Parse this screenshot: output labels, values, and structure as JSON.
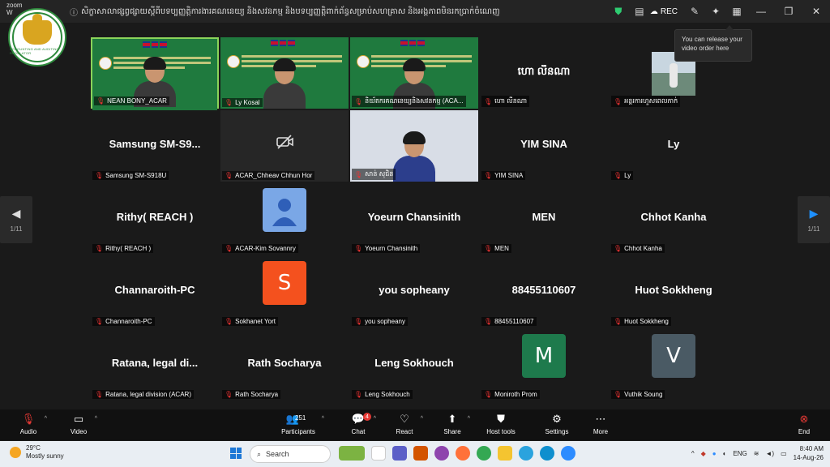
{
  "window": {
    "app_name_line1": "zoom",
    "app_name_line2": "W",
    "title": "សិក្ខាសាលាផ្សព្វផ្សាយស្ដីពីបទប្បញ្ញត្តិការងារគណនេយ្យ និងសវនកម្ម និងបទប្បញ្ញត្តិពាក់ព័ន្ធសម្រាប់សហគ្រាស និងអង្គភាពមិនរកប្រាក់ចំណេញ",
    "rec_label": "REC",
    "colors": {
      "titlebar": "#242424",
      "shield": "#2ecc71"
    }
  },
  "logo": {
    "caption": "ACCOUNTING AND AUDITING REGULATOR"
  },
  "tooltip": {
    "text": "You can release your video order here"
  },
  "tiles": [
    {
      "id": "nean",
      "name": "NEAN BONY_ACAR",
      "type": "video",
      "active": true
    },
    {
      "id": "lykosal",
      "name": "Ly Kosal",
      "type": "video"
    },
    {
      "id": "acar",
      "name": "និយ័តករគណនេយ្យនិងសវនកម្ម (ACA...",
      "type": "video"
    },
    {
      "id": "hem",
      "name": "ហោ លីនណា",
      "center": "ហោ លីនណា",
      "type": "name"
    },
    {
      "id": "anon",
      "name": "អន្តរការហួសពេលភាក់",
      "type": "photo"
    },
    {
      "id": "samsung",
      "name": "Samsung SM-S918U",
      "center": "Samsung  SM-S9...",
      "type": "name"
    },
    {
      "id": "chheav",
      "name": "ACAR_Chheav Chhun Hor",
      "type": "camoff"
    },
    {
      "id": "sothy",
      "name": "សាន់ សុជិន",
      "type": "video2"
    },
    {
      "id": "yim",
      "name": "YIM SINA",
      "center": "YIM SINA",
      "type": "name"
    },
    {
      "id": "ly",
      "name": "Ly",
      "center": "Ly",
      "type": "name"
    },
    {
      "id": "rithy",
      "name": "Rithy( REACH )",
      "center": "Rithy( REACH )",
      "type": "name"
    },
    {
      "id": "kim",
      "name": "ACAR-Kim Sovannry",
      "type": "avatar-person"
    },
    {
      "id": "yoeurn",
      "name": "Yoeurn Chansinith",
      "center": "Yoeurn Chansinith",
      "type": "name"
    },
    {
      "id": "men",
      "name": "MEN",
      "center": "MEN",
      "type": "name"
    },
    {
      "id": "chhot",
      "name": "Chhot Kanha",
      "center": "Chhot Kanha",
      "type": "name"
    },
    {
      "id": "channa",
      "name": "Channaroith-PC",
      "center": "Channaroith-PC",
      "type": "name"
    },
    {
      "id": "sokhanet",
      "name": "Sokhanet Yort",
      "avatar": "S",
      "avatar_color": "#f4511e",
      "type": "avatar"
    },
    {
      "id": "you",
      "name": "you sopheany",
      "center": "you sopheany",
      "type": "name"
    },
    {
      "id": "num",
      "name": "88455110607",
      "center": "88455110607",
      "type": "name"
    },
    {
      "id": "huot",
      "name": "Huot Sokkheng",
      "center": "Huot Sokkheng",
      "type": "name"
    },
    {
      "id": "ratana",
      "name": "Ratana, legal division (ACAR)",
      "center": "Ratana,  legal  di...",
      "type": "name"
    },
    {
      "id": "rath",
      "name": "Rath Socharya",
      "center": "Rath Socharya",
      "type": "name"
    },
    {
      "id": "leng",
      "name": "Leng Sokhouch",
      "center": "Leng Sokhouch",
      "type": "name"
    },
    {
      "id": "moni",
      "name": "Moniroth Prom",
      "avatar": "M",
      "avatar_color": "#1e7a4c",
      "type": "avatar"
    },
    {
      "id": "vuthik",
      "name": "Vuthik Soung",
      "avatar": "V",
      "avatar_color": "#4a5a64",
      "type": "avatar"
    }
  ],
  "pager": {
    "left": "1/11",
    "right": "1/11"
  },
  "toolbar": {
    "audio": "Audio",
    "video": "Video",
    "participants": "Participants",
    "participants_count": "251",
    "chat": "Chat",
    "chat_badge": "4",
    "react": "React",
    "share": "Share",
    "host_tools": "Host tools",
    "settings": "Settings",
    "more": "More",
    "end": "End"
  },
  "taskbar": {
    "temp": "29°C",
    "weather": "Mostly sunny",
    "search": "Search",
    "lang": "ENG",
    "time": "8:40 AM",
    "date": "14-Aug-26"
  }
}
